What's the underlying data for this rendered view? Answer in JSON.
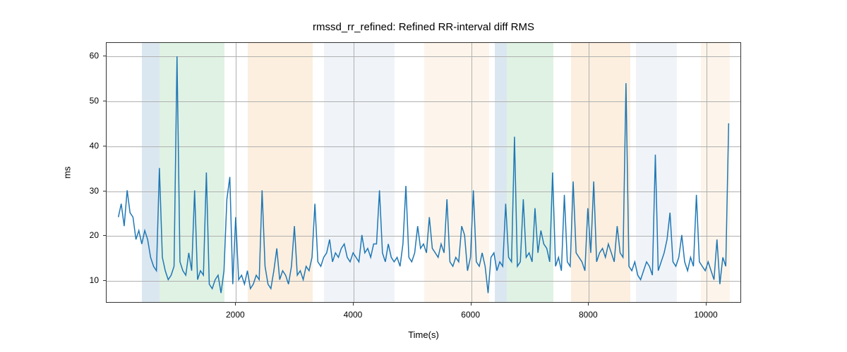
{
  "chart_data": {
    "type": "line",
    "title": "rmssd_rr_refined: Refined RR-interval diff RMS",
    "xlabel": "Time(s)",
    "ylabel": "ms",
    "xlim": [
      -200,
      10600
    ],
    "ylim": [
      5,
      63
    ],
    "yticks": [
      10,
      20,
      30,
      40,
      50,
      60
    ],
    "xticks": [
      2000,
      4000,
      6000,
      8000,
      10000
    ],
    "bands": [
      {
        "x0": 400,
        "x1": 700,
        "color": "#7fa8c9"
      },
      {
        "x0": 700,
        "x1": 1800,
        "color": "#8fd19e"
      },
      {
        "x0": 2200,
        "x1": 3300,
        "color": "#f5c58b"
      },
      {
        "x0": 3500,
        "x1": 4700,
        "color": "#c9d7e8"
      },
      {
        "x0": 5200,
        "x1": 6300,
        "color": "#f8dcb8"
      },
      {
        "x0": 6400,
        "x1": 6600,
        "color": "#7fa8c9"
      },
      {
        "x0": 6600,
        "x1": 7400,
        "color": "#8fd19e"
      },
      {
        "x0": 7700,
        "x1": 8700,
        "color": "#f5c58b"
      },
      {
        "x0": 8800,
        "x1": 9500,
        "color": "#c9d7e8"
      },
      {
        "x0": 9900,
        "x1": 10400,
        "color": "#f8dcb8"
      }
    ],
    "x": [
      0,
      50,
      100,
      150,
      200,
      250,
      300,
      350,
      400,
      450,
      500,
      550,
      600,
      650,
      700,
      750,
      800,
      850,
      900,
      950,
      1000,
      1050,
      1100,
      1150,
      1200,
      1250,
      1300,
      1350,
      1400,
      1450,
      1500,
      1550,
      1600,
      1650,
      1700,
      1750,
      1800,
      1850,
      1900,
      1950,
      2000,
      2050,
      2100,
      2150,
      2200,
      2250,
      2300,
      2350,
      2400,
      2450,
      2500,
      2550,
      2600,
      2650,
      2700,
      2750,
      2800,
      2850,
      2900,
      2950,
      3000,
      3050,
      3100,
      3150,
      3200,
      3250,
      3300,
      3350,
      3400,
      3450,
      3500,
      3550,
      3600,
      3650,
      3700,
      3750,
      3800,
      3850,
      3900,
      3950,
      4000,
      4050,
      4100,
      4150,
      4200,
      4250,
      4300,
      4350,
      4400,
      4450,
      4500,
      4550,
      4600,
      4650,
      4700,
      4750,
      4800,
      4850,
      4900,
      4950,
      5000,
      5050,
      5100,
      5150,
      5200,
      5250,
      5300,
      5350,
      5400,
      5450,
      5500,
      5550,
      5600,
      5650,
      5700,
      5750,
      5800,
      5850,
      5900,
      5950,
      6000,
      6050,
      6100,
      6150,
      6200,
      6250,
      6300,
      6350,
      6400,
      6450,
      6500,
      6550,
      6600,
      6650,
      6700,
      6750,
      6800,
      6850,
      6900,
      6950,
      7000,
      7050,
      7100,
      7150,
      7200,
      7250,
      7300,
      7350,
      7400,
      7450,
      7500,
      7550,
      7600,
      7650,
      7700,
      7750,
      7800,
      7850,
      7900,
      7950,
      8000,
      8050,
      8100,
      8150,
      8200,
      8250,
      8300,
      8350,
      8400,
      8450,
      8500,
      8550,
      8600,
      8650,
      8700,
      8750,
      8800,
      8850,
      8900,
      8950,
      9000,
      9050,
      9100,
      9150,
      9200,
      9250,
      9300,
      9350,
      9400,
      9450,
      9500,
      9550,
      9600,
      9650,
      9700,
      9750,
      9800,
      9850,
      9900,
      9950,
      10000,
      10050,
      10100,
      10150,
      10200,
      10250,
      10300,
      10350,
      10400
    ],
    "values": [
      24,
      27,
      22,
      30,
      25,
      24,
      19,
      21,
      18,
      21,
      19,
      15,
      13,
      12,
      35,
      15,
      12,
      10,
      11,
      13,
      60,
      14,
      12,
      11,
      16,
      12,
      30,
      10,
      12,
      11,
      34,
      9,
      8,
      10,
      11,
      7,
      12,
      28,
      33,
      9,
      24,
      10,
      11,
      9,
      12,
      8,
      9,
      11,
      10,
      30,
      13,
      9,
      8,
      12,
      17,
      10,
      12,
      11,
      9,
      13,
      22,
      11,
      12,
      10,
      13,
      12,
      15,
      27,
      14,
      13,
      15,
      16,
      19,
      14,
      16,
      15,
      17,
      18,
      15,
      14,
      16,
      15,
      14,
      20,
      16,
      17,
      15,
      18,
      18,
      30,
      16,
      14,
      18,
      15,
      14,
      15,
      13,
      18,
      31,
      15,
      14,
      16,
      22,
      17,
      18,
      16,
      24,
      17,
      16,
      15,
      18,
      16,
      28,
      14,
      13,
      15,
      14,
      22,
      20,
      12,
      15,
      30,
      14,
      13,
      16,
      13,
      7,
      15,
      16,
      12,
      14,
      13,
      27,
      15,
      14,
      42,
      13,
      14,
      28,
      15,
      16,
      14,
      26,
      16,
      21,
      18,
      17,
      14,
      34,
      13,
      15,
      12,
      29,
      14,
      13,
      32,
      16,
      15,
      14,
      12,
      26,
      16,
      32,
      14,
      16,
      17,
      15,
      18,
      16,
      14,
      22,
      16,
      15,
      54,
      13,
      12,
      14,
      11,
      10,
      12,
      14,
      13,
      11,
      38,
      12,
      14,
      16,
      19,
      25,
      14,
      13,
      15,
      20,
      14,
      12,
      15,
      13,
      29,
      14,
      13,
      12,
      14,
      12,
      10,
      19,
      9,
      15,
      13,
      45
    ]
  }
}
